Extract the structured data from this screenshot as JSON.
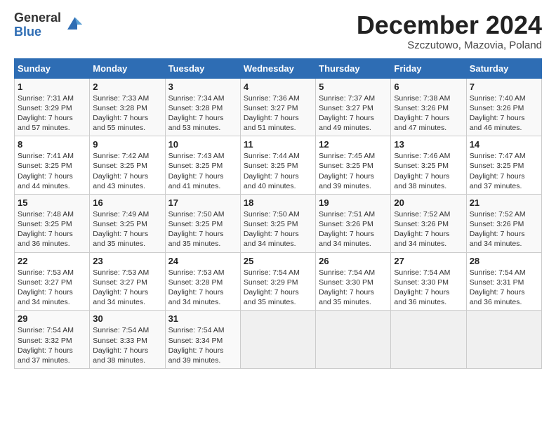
{
  "header": {
    "logo_general": "General",
    "logo_blue": "Blue",
    "month_title": "December 2024",
    "subtitle": "Szczutowo, Mazovia, Poland"
  },
  "weekdays": [
    "Sunday",
    "Monday",
    "Tuesday",
    "Wednesday",
    "Thursday",
    "Friday",
    "Saturday"
  ],
  "weeks": [
    [
      {
        "day": "1",
        "info": "Sunrise: 7:31 AM\nSunset: 3:29 PM\nDaylight: 7 hours\nand 57 minutes."
      },
      {
        "day": "2",
        "info": "Sunrise: 7:33 AM\nSunset: 3:28 PM\nDaylight: 7 hours\nand 55 minutes."
      },
      {
        "day": "3",
        "info": "Sunrise: 7:34 AM\nSunset: 3:28 PM\nDaylight: 7 hours\nand 53 minutes."
      },
      {
        "day": "4",
        "info": "Sunrise: 7:36 AM\nSunset: 3:27 PM\nDaylight: 7 hours\nand 51 minutes."
      },
      {
        "day": "5",
        "info": "Sunrise: 7:37 AM\nSunset: 3:27 PM\nDaylight: 7 hours\nand 49 minutes."
      },
      {
        "day": "6",
        "info": "Sunrise: 7:38 AM\nSunset: 3:26 PM\nDaylight: 7 hours\nand 47 minutes."
      },
      {
        "day": "7",
        "info": "Sunrise: 7:40 AM\nSunset: 3:26 PM\nDaylight: 7 hours\nand 46 minutes."
      }
    ],
    [
      {
        "day": "8",
        "info": "Sunrise: 7:41 AM\nSunset: 3:25 PM\nDaylight: 7 hours\nand 44 minutes."
      },
      {
        "day": "9",
        "info": "Sunrise: 7:42 AM\nSunset: 3:25 PM\nDaylight: 7 hours\nand 43 minutes."
      },
      {
        "day": "10",
        "info": "Sunrise: 7:43 AM\nSunset: 3:25 PM\nDaylight: 7 hours\nand 41 minutes."
      },
      {
        "day": "11",
        "info": "Sunrise: 7:44 AM\nSunset: 3:25 PM\nDaylight: 7 hours\nand 40 minutes."
      },
      {
        "day": "12",
        "info": "Sunrise: 7:45 AM\nSunset: 3:25 PM\nDaylight: 7 hours\nand 39 minutes."
      },
      {
        "day": "13",
        "info": "Sunrise: 7:46 AM\nSunset: 3:25 PM\nDaylight: 7 hours\nand 38 minutes."
      },
      {
        "day": "14",
        "info": "Sunrise: 7:47 AM\nSunset: 3:25 PM\nDaylight: 7 hours\nand 37 minutes."
      }
    ],
    [
      {
        "day": "15",
        "info": "Sunrise: 7:48 AM\nSunset: 3:25 PM\nDaylight: 7 hours\nand 36 minutes."
      },
      {
        "day": "16",
        "info": "Sunrise: 7:49 AM\nSunset: 3:25 PM\nDaylight: 7 hours\nand 35 minutes."
      },
      {
        "day": "17",
        "info": "Sunrise: 7:50 AM\nSunset: 3:25 PM\nDaylight: 7 hours\nand 35 minutes."
      },
      {
        "day": "18",
        "info": "Sunrise: 7:50 AM\nSunset: 3:25 PM\nDaylight: 7 hours\nand 34 minutes."
      },
      {
        "day": "19",
        "info": "Sunrise: 7:51 AM\nSunset: 3:26 PM\nDaylight: 7 hours\nand 34 minutes."
      },
      {
        "day": "20",
        "info": "Sunrise: 7:52 AM\nSunset: 3:26 PM\nDaylight: 7 hours\nand 34 minutes."
      },
      {
        "day": "21",
        "info": "Sunrise: 7:52 AM\nSunset: 3:26 PM\nDaylight: 7 hours\nand 34 minutes."
      }
    ],
    [
      {
        "day": "22",
        "info": "Sunrise: 7:53 AM\nSunset: 3:27 PM\nDaylight: 7 hours\nand 34 minutes."
      },
      {
        "day": "23",
        "info": "Sunrise: 7:53 AM\nSunset: 3:27 PM\nDaylight: 7 hours\nand 34 minutes."
      },
      {
        "day": "24",
        "info": "Sunrise: 7:53 AM\nSunset: 3:28 PM\nDaylight: 7 hours\nand 34 minutes."
      },
      {
        "day": "25",
        "info": "Sunrise: 7:54 AM\nSunset: 3:29 PM\nDaylight: 7 hours\nand 35 minutes."
      },
      {
        "day": "26",
        "info": "Sunrise: 7:54 AM\nSunset: 3:30 PM\nDaylight: 7 hours\nand 35 minutes."
      },
      {
        "day": "27",
        "info": "Sunrise: 7:54 AM\nSunset: 3:30 PM\nDaylight: 7 hours\nand 36 minutes."
      },
      {
        "day": "28",
        "info": "Sunrise: 7:54 AM\nSunset: 3:31 PM\nDaylight: 7 hours\nand 36 minutes."
      }
    ],
    [
      {
        "day": "29",
        "info": "Sunrise: 7:54 AM\nSunset: 3:32 PM\nDaylight: 7 hours\nand 37 minutes."
      },
      {
        "day": "30",
        "info": "Sunrise: 7:54 AM\nSunset: 3:33 PM\nDaylight: 7 hours\nand 38 minutes."
      },
      {
        "day": "31",
        "info": "Sunrise: 7:54 AM\nSunset: 3:34 PM\nDaylight: 7 hours\nand 39 minutes."
      },
      {
        "day": "",
        "info": ""
      },
      {
        "day": "",
        "info": ""
      },
      {
        "day": "",
        "info": ""
      },
      {
        "day": "",
        "info": ""
      }
    ]
  ]
}
